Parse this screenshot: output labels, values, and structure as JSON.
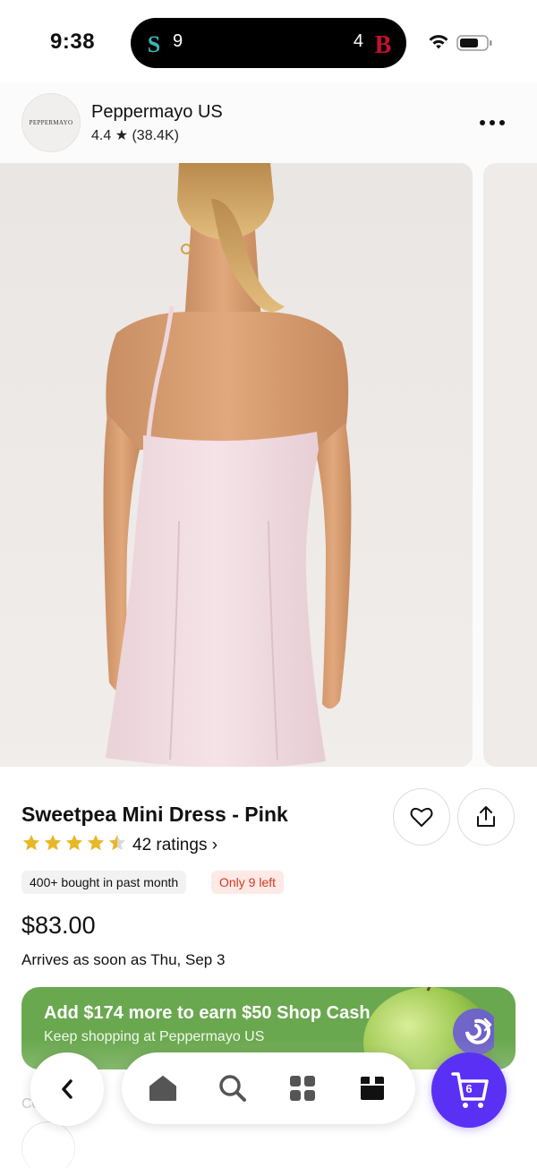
{
  "status_bar": {
    "time": "9:38",
    "live_activity": {
      "left_score": "9",
      "right_score": "4",
      "left_team_letter": "S",
      "right_team_letter": "B"
    }
  },
  "shop": {
    "logo_text": "PEPPERMAYO",
    "name": "Peppermayo US",
    "rating": "4.4 ★ (38.4K)"
  },
  "product": {
    "title": "Sweetpea Mini Dress - Pink",
    "star_rating": 4.5,
    "ratings_text": "42 ratings ›",
    "badge_bought": "400+ bought in past month",
    "badge_stock": "Only 9 left",
    "price": "$83.00",
    "arrival": "Arrives as soon as Thu, Sep 3"
  },
  "promo": {
    "title": "Add $174 more to earn $50 Shop Cash",
    "subtitle": "Keep shopping at Peppermayo US"
  },
  "partially_hidden": {
    "label": "Co"
  },
  "bottom_nav": {
    "items": [
      "home-icon",
      "search-icon",
      "grid-icon",
      "orders-box-icon"
    ],
    "cart_count": "6"
  },
  "colors": {
    "brand_purple": "#5a31f4",
    "promo_green": "#6aa84f",
    "star_gold": "#e9b625",
    "stock_red": "#d23a1e"
  }
}
